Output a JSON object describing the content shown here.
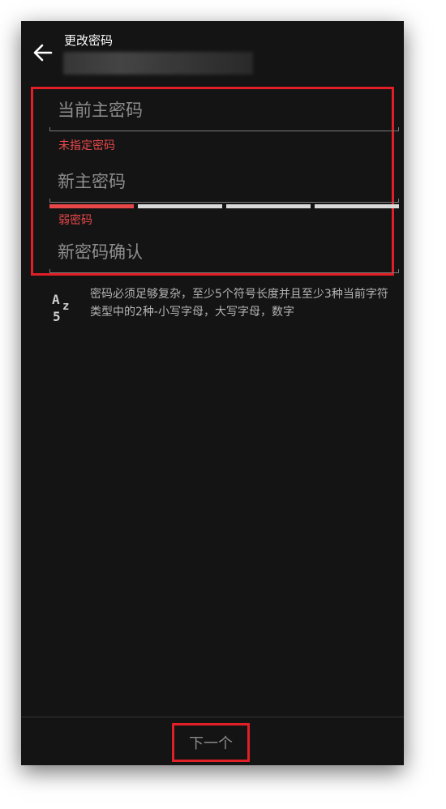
{
  "header": {
    "title": "更改密码",
    "back_icon": "arrow-left-icon"
  },
  "form": {
    "current_password": {
      "placeholder": "当前主密码",
      "value": "",
      "error": "未指定密码"
    },
    "new_password": {
      "placeholder": "新主密码",
      "value": "",
      "strength_label": "弱密码",
      "strength_level": 1,
      "strength_max": 4
    },
    "confirm_password": {
      "placeholder": "新密码确认",
      "value": ""
    }
  },
  "hint": {
    "icon": "az-complexity-icon",
    "text": "密码必须足够复杂，至少5个符号长度并且至少3种当前字符类型中的2种-小写字母，大写字母，数字"
  },
  "footer": {
    "next_label": "下一个"
  },
  "colors": {
    "background": "#141414",
    "error": "#e8474a",
    "highlight": "#e01f26"
  }
}
